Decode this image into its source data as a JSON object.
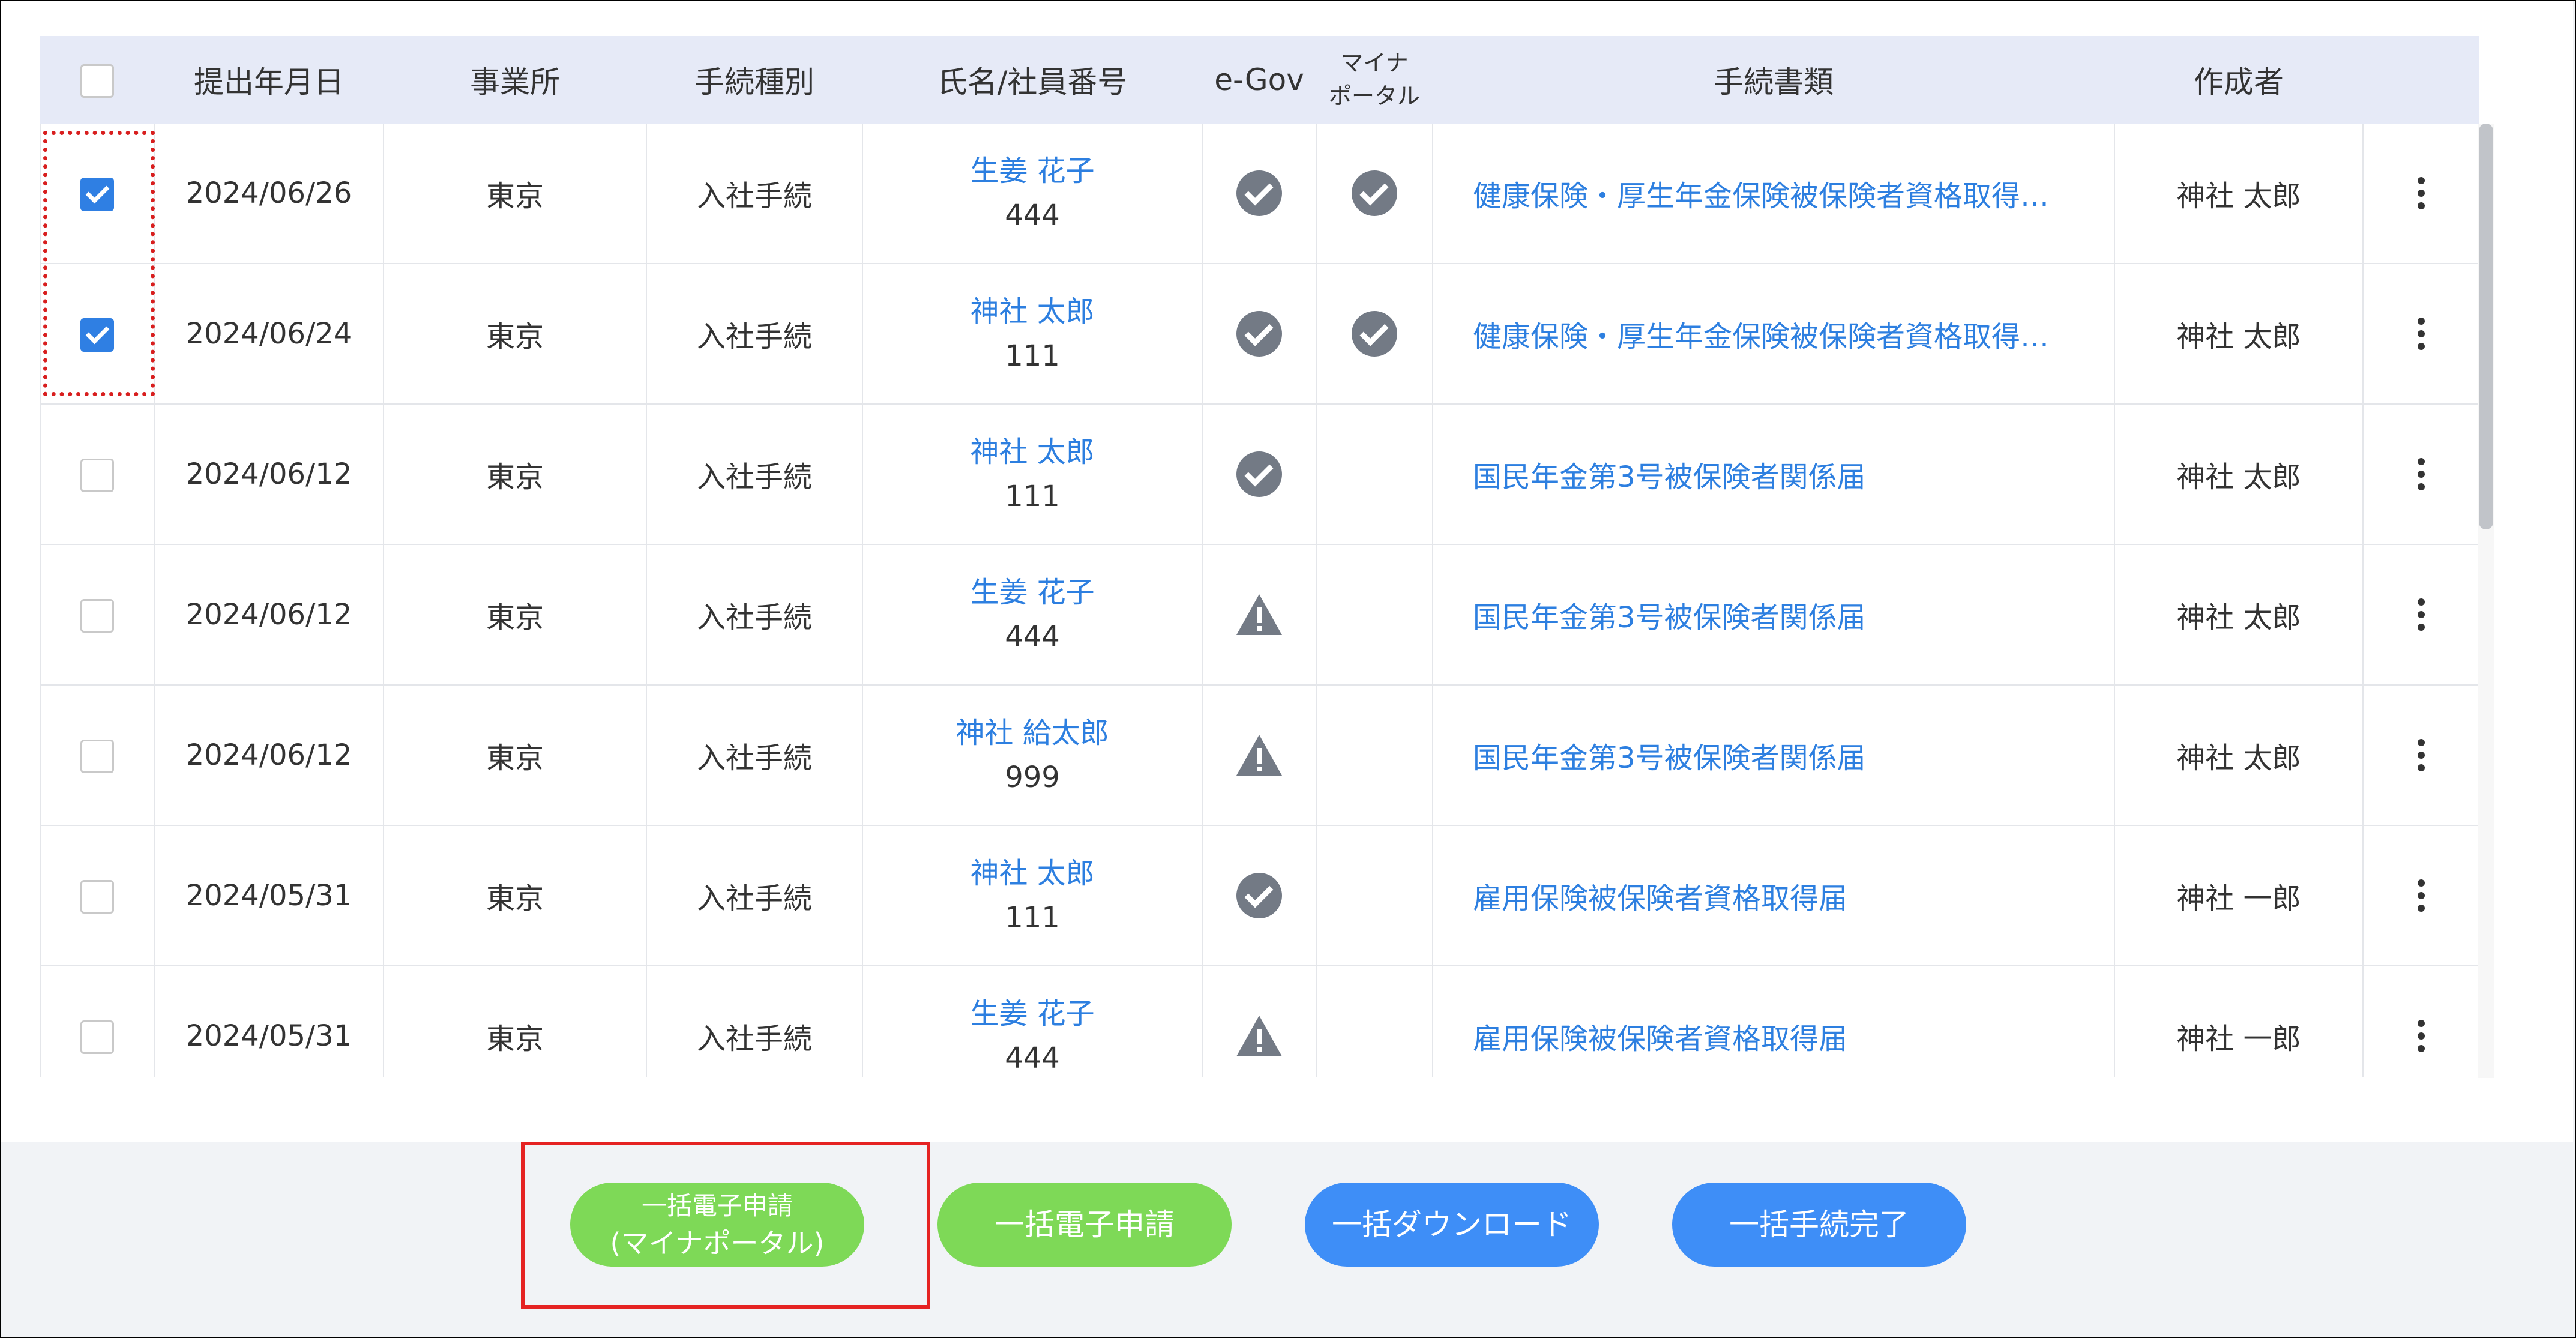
{
  "columns": {
    "select": "",
    "date": "提出年月日",
    "office": "事業所",
    "procedure_type": "手続種別",
    "name_id": "氏名/社員番号",
    "egov": "e-Gov",
    "myna_line1": "マイナ",
    "myna_line2": "ポータル",
    "documents": "手続書類",
    "creator": "作成者"
  },
  "rows": [
    {
      "checked": true,
      "date": "2024/06/26",
      "office": "東京",
      "type": "入社手続",
      "name": "生姜 花子",
      "id": "444",
      "egov": "ok",
      "myna": "ok",
      "doc": "健康保険・厚生年金保険被保険者資格取得…",
      "creator": "神社 太郎"
    },
    {
      "checked": true,
      "date": "2024/06/24",
      "office": "東京",
      "type": "入社手続",
      "name": "神社 太郎",
      "id": "111",
      "egov": "ok",
      "myna": "ok",
      "doc": "健康保険・厚生年金保険被保険者資格取得…",
      "creator": "神社 太郎"
    },
    {
      "checked": false,
      "date": "2024/06/12",
      "office": "東京",
      "type": "入社手続",
      "name": "神社 太郎",
      "id": "111",
      "egov": "ok",
      "myna": "none",
      "doc": "国民年金第3号被保険者関係届",
      "creator": "神社 太郎"
    },
    {
      "checked": false,
      "date": "2024/06/12",
      "office": "東京",
      "type": "入社手続",
      "name": "生姜 花子",
      "id": "444",
      "egov": "warn",
      "myna": "none",
      "doc": "国民年金第3号被保険者関係届",
      "creator": "神社 太郎"
    },
    {
      "checked": false,
      "date": "2024/06/12",
      "office": "東京",
      "type": "入社手続",
      "name": "神社 給太郎",
      "id": "999",
      "egov": "warn",
      "myna": "none",
      "doc": "国民年金第3号被保険者関係届",
      "creator": "神社 太郎"
    },
    {
      "checked": false,
      "date": "2024/05/31",
      "office": "東京",
      "type": "入社手続",
      "name": "神社 太郎",
      "id": "111",
      "egov": "ok",
      "myna": "none",
      "doc": "雇用保険被保険者資格取得届",
      "creator": "神社 一郎"
    },
    {
      "checked": false,
      "date": "2024/05/31",
      "office": "東京",
      "type": "入社手続",
      "name": "生姜 花子",
      "id": "444",
      "egov": "warn",
      "myna": "none",
      "doc": "雇用保険被保険者資格取得届",
      "creator": "神社 一郎"
    }
  ],
  "buttons": {
    "bulk_myna_line1": "一括電子申請",
    "bulk_myna_line2": "(マイナポータル)",
    "bulk_egov": "一括電子申請",
    "bulk_download": "一括ダウンロード",
    "bulk_complete": "一括手続完了"
  },
  "colors": {
    "header_bg": "#e6eaf7",
    "link": "#2d7fe0",
    "checkbox_checked": "#2f7fe3",
    "button_green": "#7ed957",
    "button_blue": "#3e8ef7",
    "highlight_red": "#e52222",
    "status_icon": "#737a85"
  },
  "icons": {
    "ok": "check-circle-icon",
    "warn": "warning-triangle-icon",
    "menu": "kebab-menu-icon"
  }
}
